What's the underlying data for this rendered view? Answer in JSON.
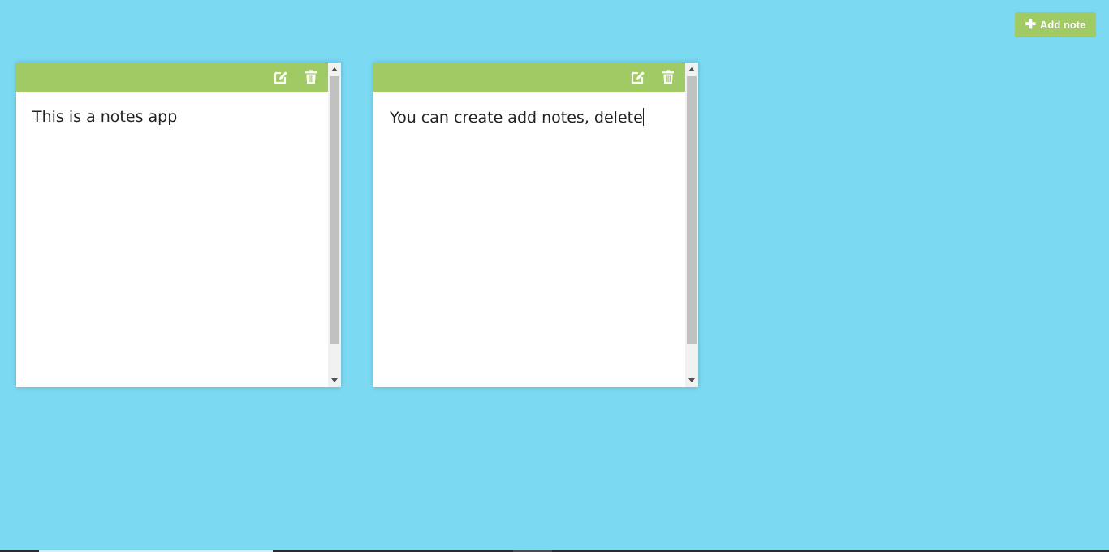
{
  "colors": {
    "background": "#7bd9f1",
    "accent": "#a0ca63",
    "note_background": "#ffffff",
    "text": "#222222"
  },
  "header": {
    "add_button": {
      "icon": "plus-icon",
      "label": "Add note"
    }
  },
  "notes": [
    {
      "text": "This is a notes app",
      "toolbar": {
        "edit_icon": "edit-icon",
        "delete_icon": "trash-icon"
      }
    },
    {
      "text": "You can create add notes, delete",
      "toolbar": {
        "edit_icon": "edit-icon",
        "delete_icon": "trash-icon"
      }
    }
  ]
}
